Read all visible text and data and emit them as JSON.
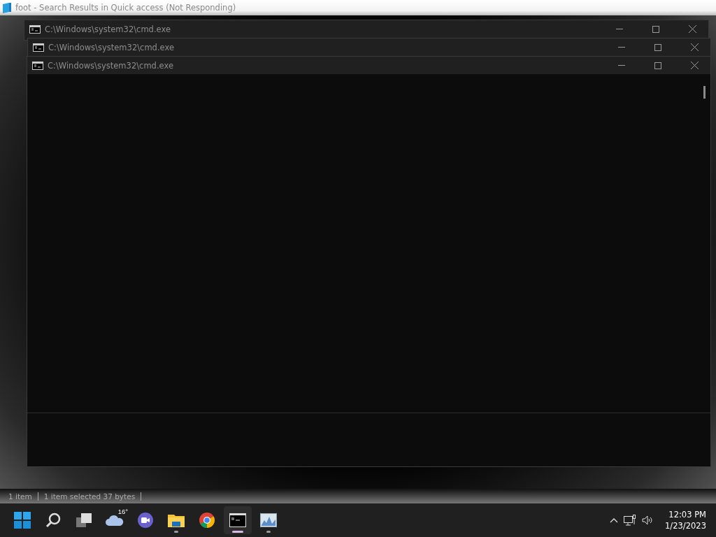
{
  "explorer": {
    "title": "foot - Search Results in Quick access (Not Responding)",
    "status_items": [
      "1 item",
      "1 item selected  37 bytes"
    ]
  },
  "cmd_windows": [
    {
      "title": "C:\\Windows\\system32\\cmd.exe"
    },
    {
      "title": "C:\\Windows\\system32\\cmd.exe"
    },
    {
      "title": "C:\\Windows\\system32\\cmd.exe"
    }
  ],
  "taskbar": {
    "apps": [
      {
        "kind": "start",
        "running": false,
        "selected": false
      },
      {
        "kind": "search",
        "running": false,
        "selected": false
      },
      {
        "kind": "taskview",
        "running": false,
        "selected": false
      },
      {
        "kind": "weather",
        "label": "16°",
        "running": false,
        "selected": false
      },
      {
        "kind": "chat",
        "running": false,
        "selected": false
      },
      {
        "kind": "files",
        "running": true,
        "selected": false
      },
      {
        "kind": "browser",
        "running": false,
        "selected": false
      },
      {
        "kind": "terminal",
        "running": true,
        "selected": true
      },
      {
        "kind": "monitor",
        "running": true,
        "selected": false
      }
    ],
    "clock": {
      "time": "12:03 PM",
      "date": "1/23/2023"
    }
  }
}
